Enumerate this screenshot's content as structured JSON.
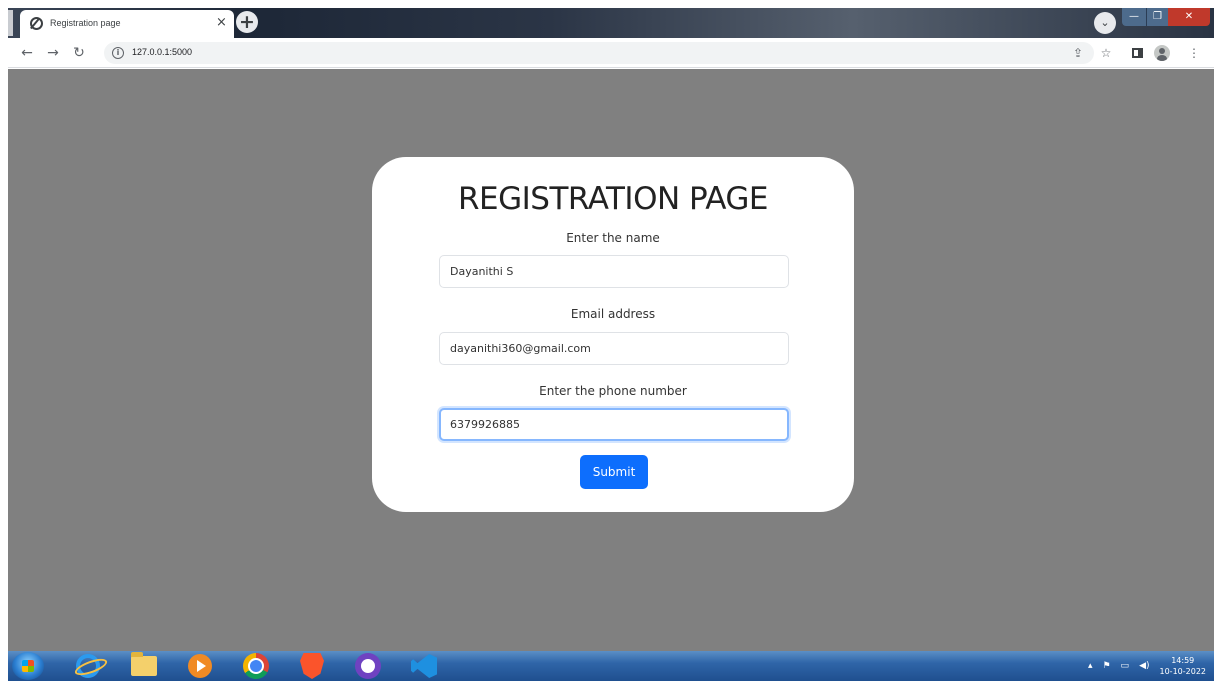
{
  "browser": {
    "tab_title": "Registration page",
    "tab_close": "×",
    "new_tab": "+",
    "url": "127.0.0.1:5000",
    "window_controls": {
      "minimize": "—",
      "maximize": "❐",
      "close": "✕"
    }
  },
  "page": {
    "background_color": "#808080",
    "title": "REGISTRATION PAGE",
    "fields": [
      {
        "label": "Enter the name",
        "value": "Dayanithi S"
      },
      {
        "label": "Email address",
        "value": "dayanithi360@gmail.com"
      },
      {
        "label": "Enter the phone number",
        "value": "6379926885"
      }
    ],
    "submit_label": "Submit",
    "accent_color": "#0d6efd"
  },
  "taskbar": {
    "apps": [
      "start-orb",
      "internet-explorer-icon",
      "file-explorer-icon",
      "media-player-icon",
      "chrome-icon",
      "brave-icon",
      "github-desktop-icon",
      "vscode-icon"
    ],
    "clock": {
      "time": "14:59",
      "date": "10-10-2022"
    }
  }
}
